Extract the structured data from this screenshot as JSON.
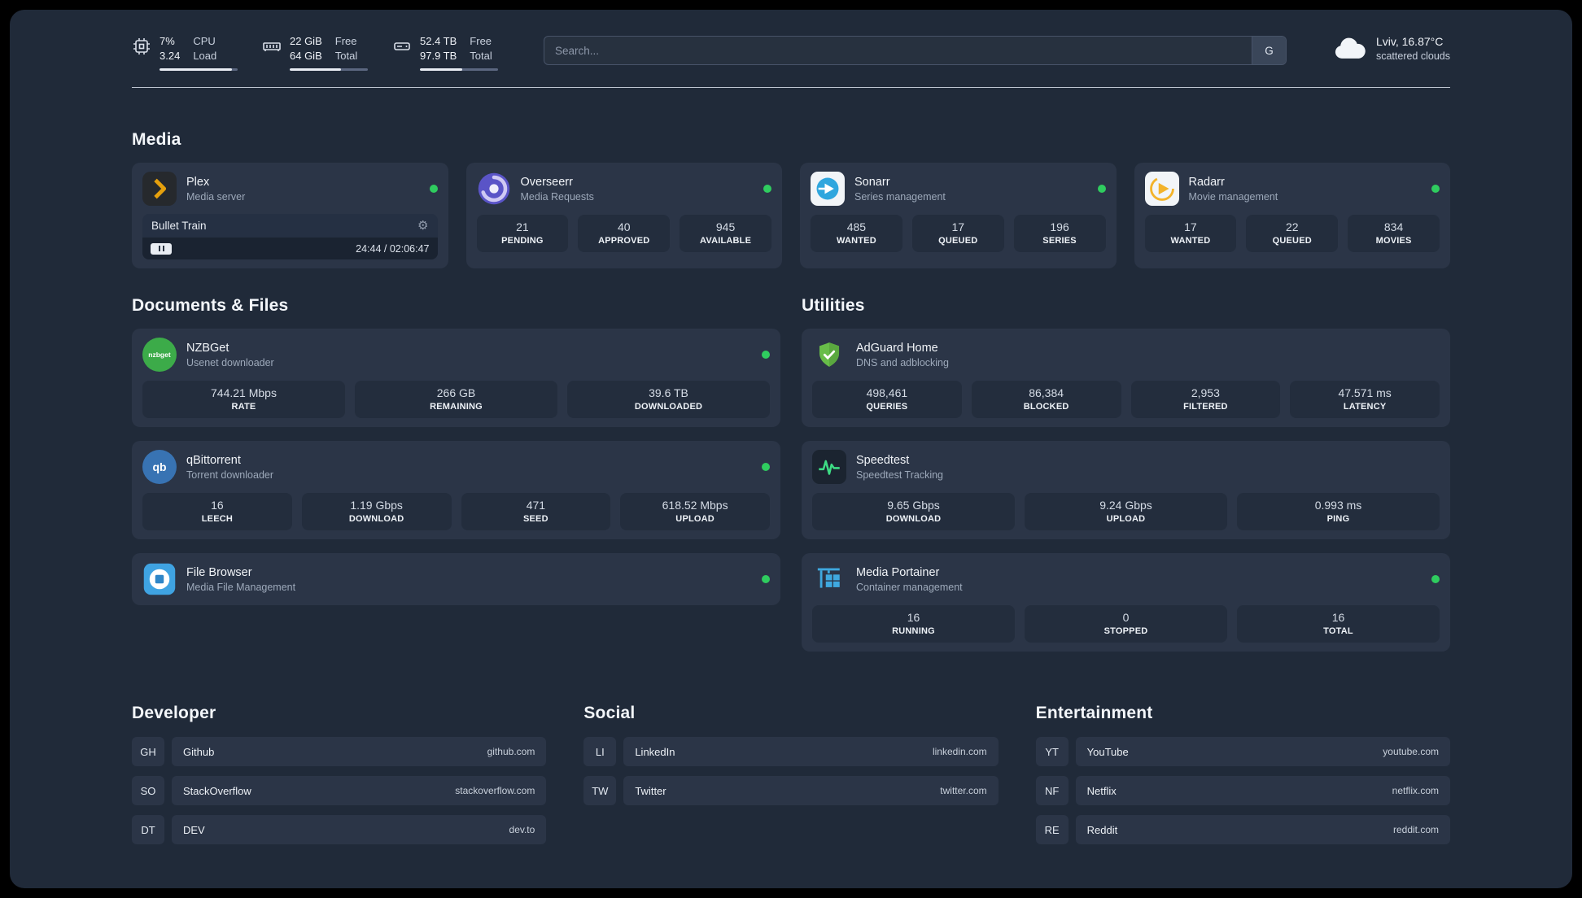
{
  "topbar": {
    "cpu": {
      "percent": "7%",
      "load": "3.24",
      "label_top": "CPU",
      "label_bottom": "Load"
    },
    "ram": {
      "free": "22 GiB",
      "total": "64 GiB",
      "label_top": "Free",
      "label_bottom": "Total"
    },
    "disk": {
      "free": "52.4 TB",
      "total": "97.9 TB",
      "label_top": "Free",
      "label_bottom": "Total"
    },
    "search": {
      "placeholder": "Search...",
      "button": "G"
    },
    "weather": {
      "location": "Lviv, 16.87°C",
      "condition": "scattered clouds"
    }
  },
  "media": {
    "title": "Media",
    "plex": {
      "name": "Plex",
      "desc": "Media server",
      "now_playing": "Bullet Train",
      "time": "24:44 / 02:06:47"
    },
    "overseerr": {
      "name": "Overseerr",
      "desc": "Media Requests",
      "stats": [
        {
          "value": "21",
          "label": "PENDING"
        },
        {
          "value": "40",
          "label": "APPROVED"
        },
        {
          "value": "945",
          "label": "AVAILABLE"
        }
      ]
    },
    "sonarr": {
      "name": "Sonarr",
      "desc": "Series management",
      "stats": [
        {
          "value": "485",
          "label": "WANTED"
        },
        {
          "value": "17",
          "label": "QUEUED"
        },
        {
          "value": "196",
          "label": "SERIES"
        }
      ]
    },
    "radarr": {
      "name": "Radarr",
      "desc": "Movie management",
      "stats": [
        {
          "value": "17",
          "label": "WANTED"
        },
        {
          "value": "22",
          "label": "QUEUED"
        },
        {
          "value": "834",
          "label": "MOVIES"
        }
      ]
    }
  },
  "documents": {
    "title": "Documents & Files",
    "nzbget": {
      "name": "NZBGet",
      "desc": "Usenet downloader",
      "icon_text": "nzbget",
      "stats": [
        {
          "value": "744.21 Mbps",
          "label": "RATE"
        },
        {
          "value": "266 GB",
          "label": "REMAINING"
        },
        {
          "value": "39.6 TB",
          "label": "DOWNLOADED"
        }
      ]
    },
    "qbittorrent": {
      "name": "qBittorrent",
      "desc": "Torrent downloader",
      "icon_text": "qb",
      "stats": [
        {
          "value": "16",
          "label": "LEECH"
        },
        {
          "value": "1.19 Gbps",
          "label": "DOWNLOAD"
        },
        {
          "value": "471",
          "label": "SEED"
        },
        {
          "value": "618.52 Mbps",
          "label": "UPLOAD"
        }
      ]
    },
    "filebrowser": {
      "name": "File Browser",
      "desc": "Media File Management"
    }
  },
  "utilities": {
    "title": "Utilities",
    "adguard": {
      "name": "AdGuard Home",
      "desc": "DNS and adblocking",
      "stats": [
        {
          "value": "498,461",
          "label": "QUERIES"
        },
        {
          "value": "86,384",
          "label": "BLOCKED"
        },
        {
          "value": "2,953",
          "label": "FILTERED"
        },
        {
          "value": "47.571 ms",
          "label": "LATENCY"
        }
      ]
    },
    "speedtest": {
      "name": "Speedtest",
      "desc": "Speedtest Tracking",
      "stats": [
        {
          "value": "9.65 Gbps",
          "label": "DOWNLOAD"
        },
        {
          "value": "9.24 Gbps",
          "label": "UPLOAD"
        },
        {
          "value": "0.993 ms",
          "label": "PING"
        }
      ]
    },
    "portainer": {
      "name": "Media Portainer",
      "desc": "Container management",
      "stats": [
        {
          "value": "16",
          "label": "RUNNING"
        },
        {
          "value": "0",
          "label": "STOPPED"
        },
        {
          "value": "16",
          "label": "TOTAL"
        }
      ]
    }
  },
  "bookmarks": {
    "developer": {
      "title": "Developer",
      "items": [
        {
          "abbr": "GH",
          "name": "Github",
          "url": "github.com"
        },
        {
          "abbr": "SO",
          "name": "StackOverflow",
          "url": "stackoverflow.com"
        },
        {
          "abbr": "DT",
          "name": "DEV",
          "url": "dev.to"
        }
      ]
    },
    "social": {
      "title": "Social",
      "items": [
        {
          "abbr": "LI",
          "name": "LinkedIn",
          "url": "linkedin.com"
        },
        {
          "abbr": "TW",
          "name": "Twitter",
          "url": "twitter.com"
        }
      ]
    },
    "entertainment": {
      "title": "Entertainment",
      "items": [
        {
          "abbr": "YT",
          "name": "YouTube",
          "url": "youtube.com"
        },
        {
          "abbr": "NF",
          "name": "Netflix",
          "url": "netflix.com"
        },
        {
          "abbr": "RE",
          "name": "Reddit",
          "url": "reddit.com"
        }
      ]
    }
  },
  "colors": {
    "status_online": "#2fcc5f",
    "accent_green": "#3ddc84",
    "plex_amber": "#e5a00d"
  }
}
